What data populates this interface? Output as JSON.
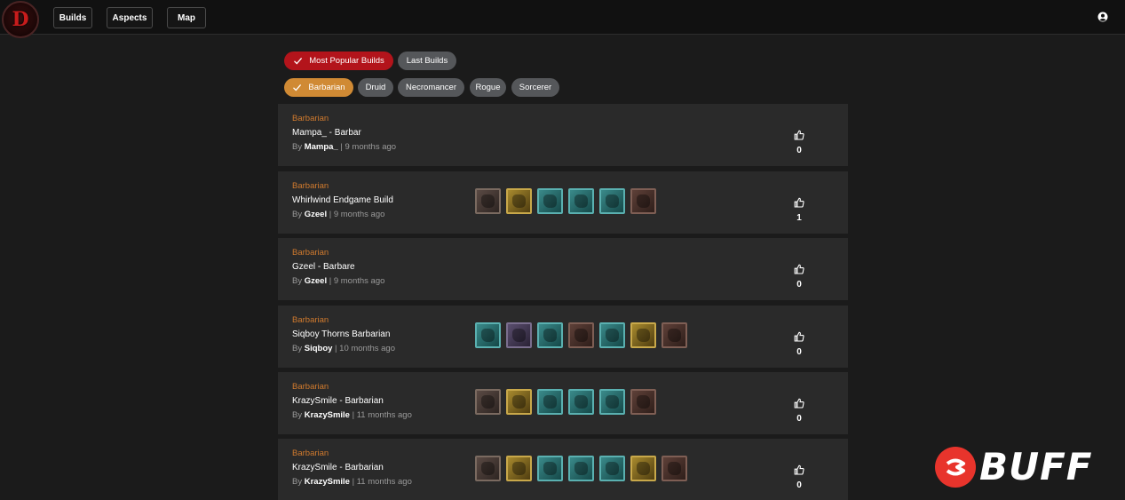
{
  "nav": {
    "logo_letter": "D",
    "items": [
      {
        "label": "Builds"
      },
      {
        "label": "Aspects"
      },
      {
        "label": "Map"
      }
    ],
    "user_icon": "user-circle-icon"
  },
  "sort_filters": [
    {
      "label": "Most Popular Builds",
      "selected": true,
      "color": "#b3141b"
    },
    {
      "label": "Last Builds",
      "selected": false,
      "color": "#55575a"
    }
  ],
  "class_filters": [
    {
      "label": "Barbarian",
      "selected": true,
      "color": "#d08a34"
    },
    {
      "label": "Druid",
      "selected": false
    },
    {
      "label": "Necromancer",
      "selected": false
    },
    {
      "label": "Rogue",
      "selected": false
    },
    {
      "label": "Sorcerer",
      "selected": false
    }
  ],
  "builds": [
    {
      "class": "Barbarian",
      "title": "Mampa_ - Barbar",
      "by": "By",
      "author": "Mampa_",
      "time": "| 9 months ago",
      "likes": "0",
      "skills": []
    },
    {
      "class": "Barbarian",
      "title": "Whirlwind Endgame Build",
      "by": "By",
      "author": "Gzeel",
      "time": "| 9 months ago",
      "likes": "1",
      "skills": [
        "brown",
        "gold",
        "teal",
        "teal",
        "teal",
        "rust"
      ]
    },
    {
      "class": "Barbarian",
      "title": "Gzeel - Barbare",
      "by": "By",
      "author": "Gzeel",
      "time": "| 9 months ago",
      "likes": "0",
      "skills": []
    },
    {
      "class": "Barbarian",
      "title": "Siqboy Thorns Barbarian",
      "by": "By",
      "author": "Siqboy",
      "time": "| 10 months ago",
      "likes": "0",
      "skills": [
        "teal",
        "purple",
        "teal",
        "rust",
        "teal",
        "gold",
        "rust"
      ]
    },
    {
      "class": "Barbarian",
      "title": "KrazySmile - Barbarian",
      "by": "By",
      "author": "KrazySmile",
      "time": "| 11 months ago",
      "likes": "0",
      "skills": [
        "brown",
        "gold",
        "teal",
        "teal",
        "teal",
        "rust"
      ]
    },
    {
      "class": "Barbarian",
      "title": "KrazySmile - Barbarian",
      "by": "By",
      "author": "KrazySmile",
      "time": "| 11 months ago",
      "likes": "0",
      "skills": [
        "brown",
        "gold",
        "teal",
        "teal",
        "teal",
        "gold",
        "rust"
      ]
    }
  ],
  "watermark": {
    "text": "BUFF",
    "color": "#e8342c"
  }
}
